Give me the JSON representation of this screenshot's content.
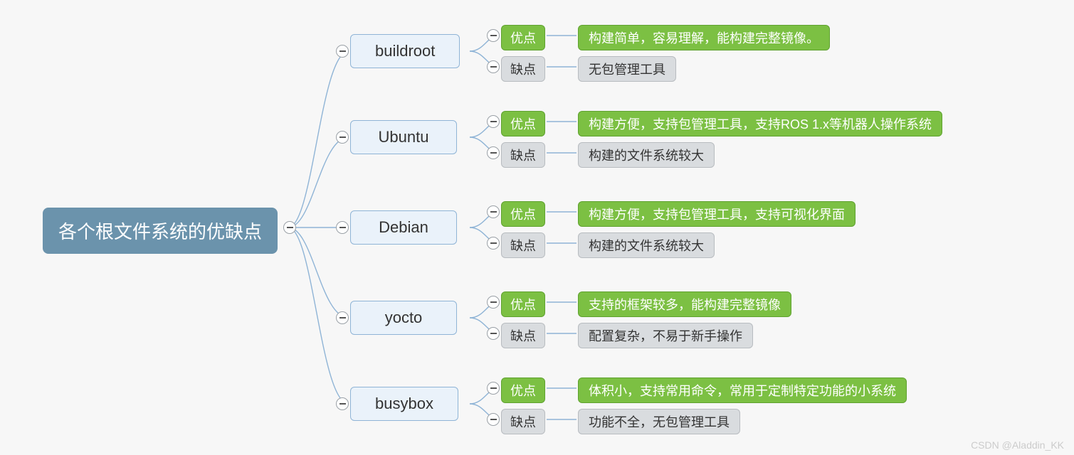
{
  "root": {
    "label": "各个根文件系统的优缺点"
  },
  "pro_label": "优点",
  "con_label": "缺点",
  "distros": [
    {
      "name": "buildroot",
      "pro": "构建简单，容易理解，能构建完整镜像。",
      "con": "无包管理工具"
    },
    {
      "name": "Ubuntu",
      "pro": "构建方便，支持包管理工具，支持ROS 1.x等机器人操作系统",
      "con": "构建的文件系统较大"
    },
    {
      "name": "Debian",
      "pro": "构建方便，支持包管理工具，支持可视化界面",
      "con": "构建的文件系统较大"
    },
    {
      "name": "yocto",
      "pro": "支持的框架较多，能构建完整镜像",
      "con": "配置复杂，不易于新手操作"
    },
    {
      "name": "busybox",
      "pro": "体积小，支持常用命令，常用于定制特定功能的小系统",
      "con": "功能不全，无包管理工具"
    }
  ],
  "watermark": "CSDN @Aladdin_KK"
}
